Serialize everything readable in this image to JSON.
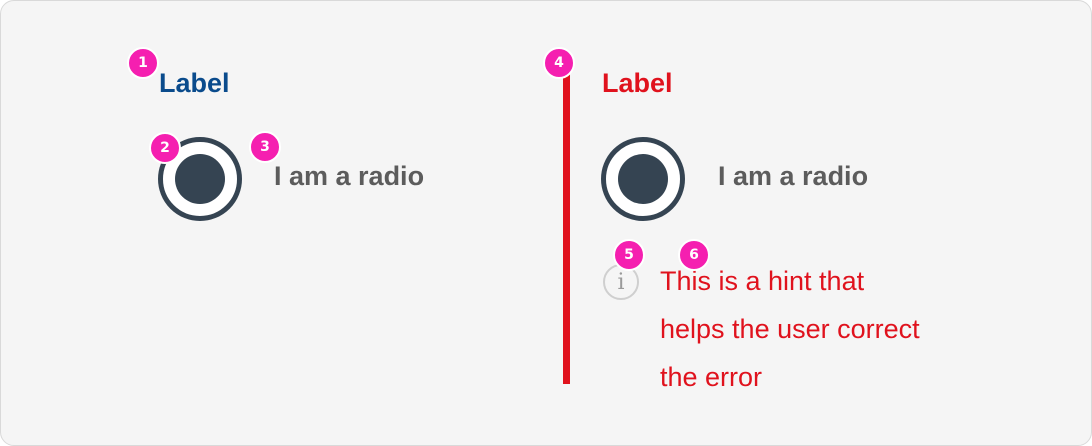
{
  "left_example": {
    "label": "Label",
    "radio_text": "I am a radio",
    "badges": [
      "1",
      "2",
      "3"
    ]
  },
  "right_example": {
    "label": "Label",
    "radio_text": "I am a radio",
    "hint_lines": [
      "This is a hint that",
      "helps the user correct",
      "the error"
    ],
    "info_icon_glyph": "i",
    "badges": [
      "4",
      "5",
      "6"
    ]
  },
  "colors": {
    "label_normal": "#0a4b8c",
    "label_error": "#e0121d",
    "radio": "#354452",
    "badge": "#f51fb0",
    "radio_text": "#5c5c5c"
  },
  "icons": {
    "radio": "radio-selected-icon",
    "info": "info-icon"
  }
}
